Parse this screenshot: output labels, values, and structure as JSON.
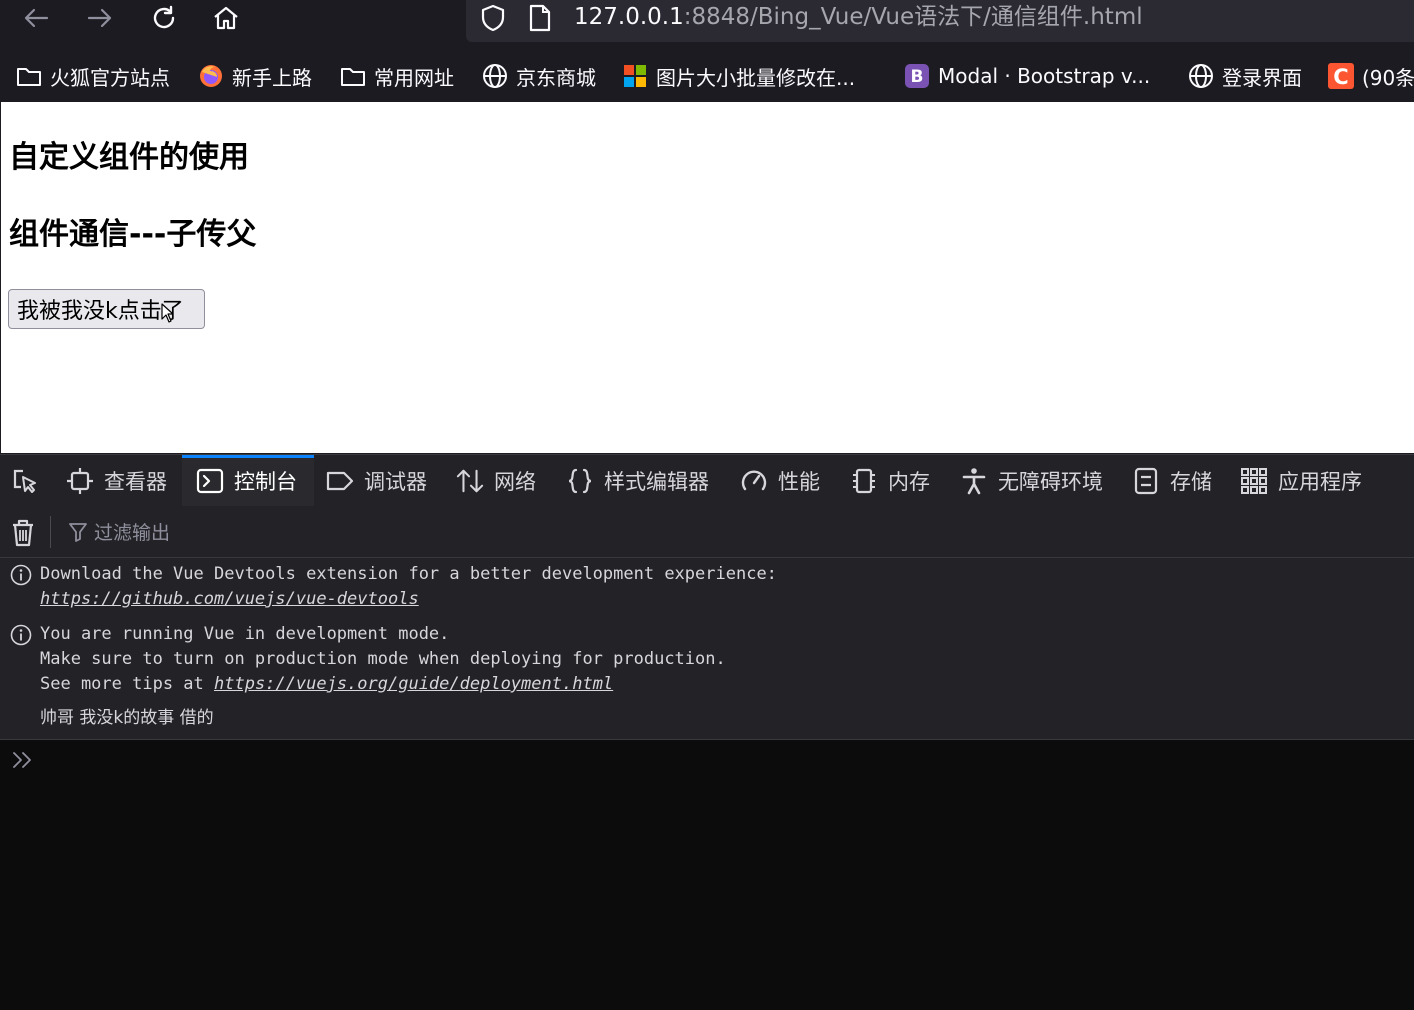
{
  "browser": {
    "url_host": "127.0.0.1",
    "url_path": ":8848/Bing_Vue/Vue语法下/通信组件.html",
    "bookmarks": [
      {
        "label": "火狐官方站点",
        "icon": "folder-icon"
      },
      {
        "label": "新手上路",
        "icon": "firefox-icon"
      },
      {
        "label": "常用网址",
        "icon": "folder-icon"
      },
      {
        "label": "京东商城",
        "icon": "globe-icon"
      },
      {
        "label": "图片大小批量修改在...",
        "icon": "colorful-squares-icon"
      },
      {
        "label": "Modal · Bootstrap v...",
        "icon": "bootstrap-icon"
      },
      {
        "label": "登录界面",
        "icon": "globe-icon"
      },
      {
        "label": "(90条",
        "icon": "csdn-icon"
      }
    ]
  },
  "page": {
    "title": "自定义组件的使用",
    "subtitle": "组件通信---子传父",
    "button_label": "我被我没k点击了"
  },
  "devtools": {
    "tabs": [
      {
        "label": "",
        "icon": "element-picker-icon"
      },
      {
        "label": "查看器",
        "icon": "inspector-icon"
      },
      {
        "label": "控制台",
        "icon": "console-icon",
        "active": true
      },
      {
        "label": "调试器",
        "icon": "debugger-icon"
      },
      {
        "label": "网络",
        "icon": "network-icon"
      },
      {
        "label": "样式编辑器",
        "icon": "style-editor-icon"
      },
      {
        "label": "性能",
        "icon": "performance-icon"
      },
      {
        "label": "内存",
        "icon": "memory-icon"
      },
      {
        "label": "无障碍环境",
        "icon": "accessibility-icon"
      },
      {
        "label": "存储",
        "icon": "storage-icon"
      },
      {
        "label": "应用程序",
        "icon": "application-icon"
      }
    ],
    "filter_placeholder": "过滤输出",
    "messages": {
      "m1_line1": "Download the Vue Devtools extension for a better development experience:",
      "m1_link": "https://github.com/vuejs/vue-devtools",
      "m2_line1": "You are running Vue in development mode.",
      "m2_line2": "Make sure to turn on production mode when deploying for production.",
      "m2_line3_prefix": "See more tips at ",
      "m2_link": "https://vuejs.org/guide/deployment.html",
      "m3": "帅哥 我没k的故事 借的"
    }
  }
}
